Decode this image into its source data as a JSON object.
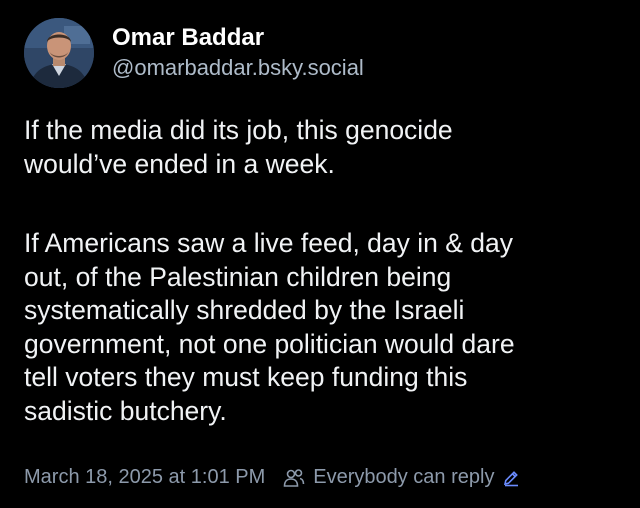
{
  "author": {
    "display_name": "Omar Baddar",
    "handle": "@omarbaddar.bsky.social"
  },
  "post": {
    "paragraph1": [
      "If the media did its job, this genocide",
      "would’ve ended in a week."
    ],
    "paragraph2": [
      "If Americans saw a live feed, day in & day",
      "out, of the Palestinian children being",
      "systematically shredded by the Israeli",
      "government, not one politician would dare",
      "tell voters they must keep funding this",
      "sadistic butchery."
    ]
  },
  "meta": {
    "timestamp": "March 18, 2025 at 1:01 PM",
    "reply_setting": "Everybody can reply",
    "icons": [
      "people-icon",
      "pencil-icon"
    ]
  },
  "colors": {
    "background": "#000000",
    "text": "#f1f3f5",
    "handle": "#aebbc9",
    "meta": "#8d9aab",
    "accent": "#6b8cff"
  }
}
